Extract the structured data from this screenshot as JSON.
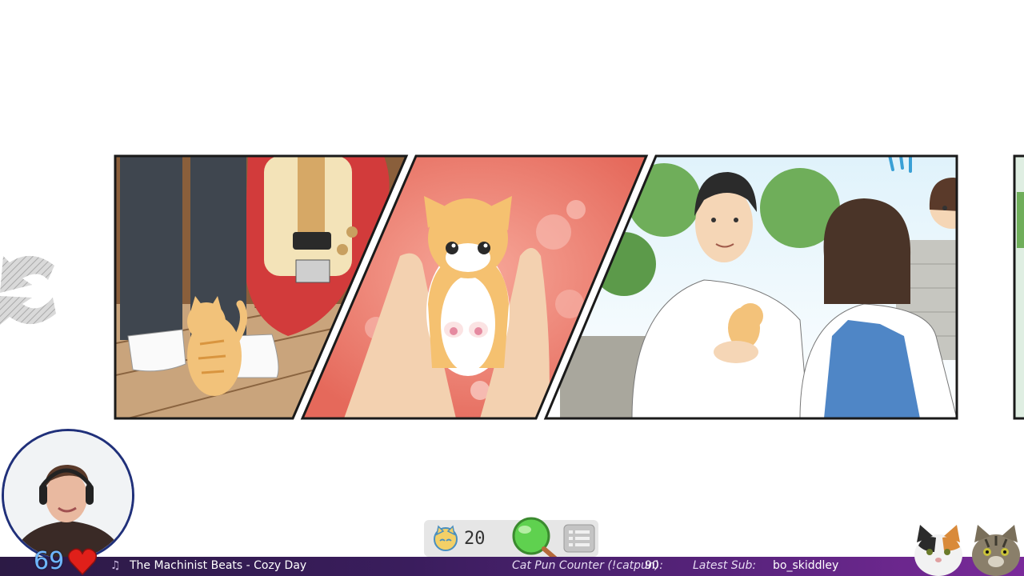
{
  "hud": {
    "coin_count": "20"
  },
  "stream": {
    "viewer_count": "69",
    "now_playing": "The Machinist Beats - Cozy Day",
    "cat_pun_label": "Cat Pun Counter (!catpun):",
    "cat_pun_value": "90",
    "latest_sub_label": "Latest Sub:",
    "latest_sub_value": "bo_skiddley"
  },
  "icons": {
    "back": "back-arrow-icon",
    "coin": "cat-coin-icon",
    "hint": "magnifier-icon",
    "menu": "list-menu-icon",
    "music": "music-note-icon",
    "heart": "heart-icon"
  },
  "colors": {
    "hud_bg": "#e6e6e6",
    "bar_start": "#2c1a45",
    "bar_end": "#7a2a9a",
    "viewer_text": "#6fb6ff",
    "panel2_bg": "#ea7a6c"
  }
}
